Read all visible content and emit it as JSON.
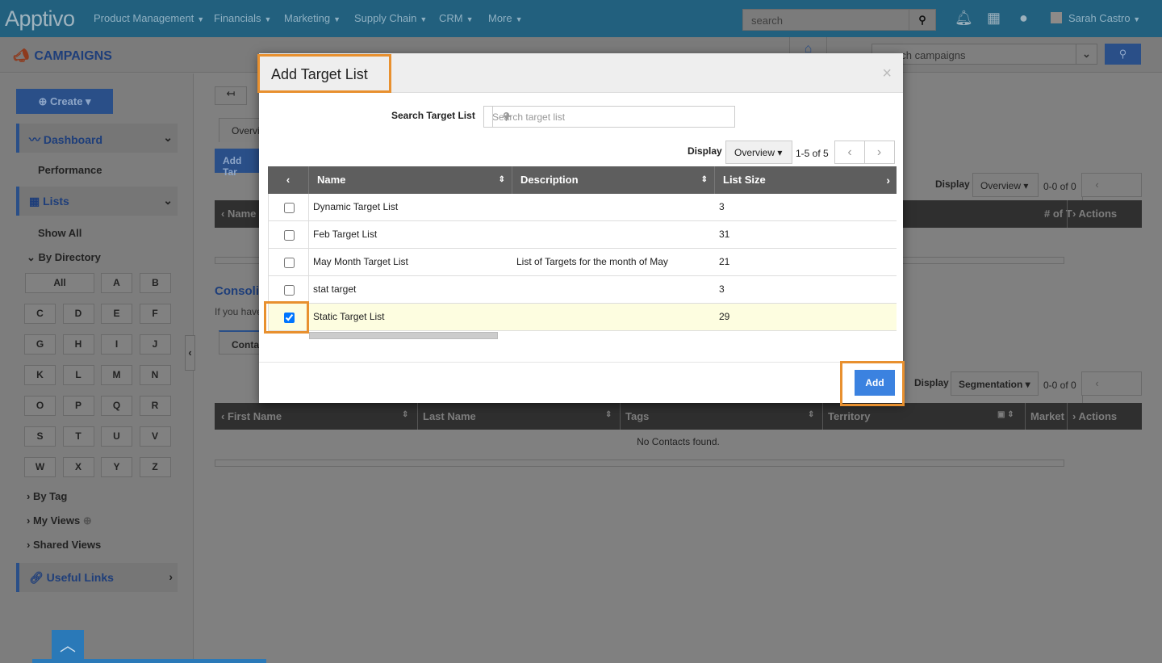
{
  "topbar": {
    "logo": "Apptivo",
    "nav": [
      "Product Management",
      "Financials",
      "Marketing",
      "Supply Chain",
      "CRM",
      "More"
    ],
    "search_placeholder": "search",
    "user": "Sarah Castro",
    "icons": [
      "bell-icon",
      "store-icon",
      "people-icon"
    ]
  },
  "subbar": {
    "app": "CAMPAIGNS",
    "search_placeholder": "search campaigns"
  },
  "sidebar": {
    "create": "Create",
    "dashboard": "Dashboard",
    "performance": "Performance",
    "lists": "Lists",
    "show_all": "Show All",
    "by_directory": "By Directory",
    "letters": [
      "All",
      "A",
      "B",
      "C",
      "D",
      "E",
      "F",
      "G",
      "H",
      "I",
      "J",
      "K",
      "L",
      "M",
      "N",
      "O",
      "P",
      "Q",
      "R",
      "S",
      "T",
      "U",
      "V",
      "W",
      "X",
      "Y",
      "Z"
    ],
    "by_tag": "By Tag",
    "my_views": "My Views",
    "shared_views": "Shared Views",
    "useful_links": "Useful Links"
  },
  "main": {
    "tab_overview": "Overvi",
    "add_target": "Add Tar",
    "name_col": "Name",
    "num_col": "# of T",
    "actions": "Actions",
    "display": "Display",
    "display_value": "Overview",
    "count": "0-0 of 0",
    "consolidated": "Consoli",
    "consolidated_desc": "If you have",
    "tab_contacts": "Conta",
    "display2_value": "Segmentation",
    "count2": "0-0 of 0",
    "contact_columns": [
      "First Name",
      "Last Name",
      "Tags",
      "Territory",
      "Market"
    ],
    "contact_actions": "Actions",
    "empty": "No Contacts found."
  },
  "modal": {
    "title": "Add Target List",
    "close": "×",
    "search_label": "Search Target List",
    "search_placeholder": "Search target list",
    "display": "Display",
    "display_value": "Overview",
    "count": "1-5 of 5",
    "columns": [
      "Name",
      "Description",
      "List Size"
    ],
    "rows": [
      {
        "name": "Dynamic Target List",
        "description": "",
        "size": "3",
        "checked": false
      },
      {
        "name": "Feb Target List",
        "description": "",
        "size": "31",
        "checked": false
      },
      {
        "name": "May Month Target List",
        "description": "List of Targets for the month of May",
        "size": "21",
        "checked": false
      },
      {
        "name": "stat target",
        "description": "",
        "size": "3",
        "checked": false
      },
      {
        "name": "Static Target List",
        "description": "",
        "size": "29",
        "checked": true
      }
    ],
    "add": "Add"
  },
  "colors": {
    "accent": "#3b82e0",
    "highlight": "#e8902f",
    "selected_row": "#fdfde0"
  }
}
